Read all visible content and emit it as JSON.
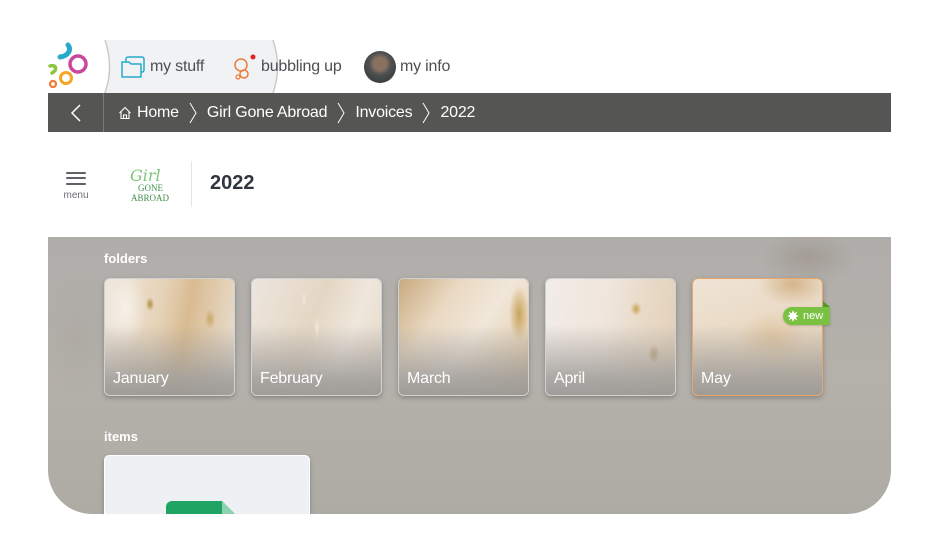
{
  "top_nav": {
    "logo": "app-logo-bubbles",
    "tabs": [
      {
        "label": "my stuff",
        "icon": "folders-icon",
        "active": true
      },
      {
        "label": "bubbling up",
        "icon": "bubbles-icon",
        "notification": true
      },
      {
        "label": "my info",
        "icon": "avatar"
      }
    ]
  },
  "breadcrumb": {
    "back_icon": "chevron-left-icon",
    "items": [
      {
        "label": "Home",
        "icon": "home-icon"
      },
      {
        "label": "Girl Gone Abroad"
      },
      {
        "label": "Invoices"
      },
      {
        "label": "2022"
      }
    ]
  },
  "header": {
    "menu_label": "menu",
    "brand_logo_lines": [
      "Girl",
      "GONE",
      "ABROAD"
    ],
    "title": "2022"
  },
  "content": {
    "folders_label": "folders",
    "folders": [
      {
        "name": "January"
      },
      {
        "name": "February"
      },
      {
        "name": "March"
      },
      {
        "name": "April"
      },
      {
        "name": "May",
        "badge": "new"
      }
    ],
    "items_label": "items",
    "items": [
      {
        "type": "spreadsheet"
      }
    ]
  },
  "colors": {
    "breadcrumb_bg": "#555553",
    "active_tab_bg": "#f1f2f3",
    "new_badge": "#7ac143",
    "title_text": "#2f3640",
    "accent_teal": "#29a9c9",
    "accent_orange": "#f07a3a"
  }
}
